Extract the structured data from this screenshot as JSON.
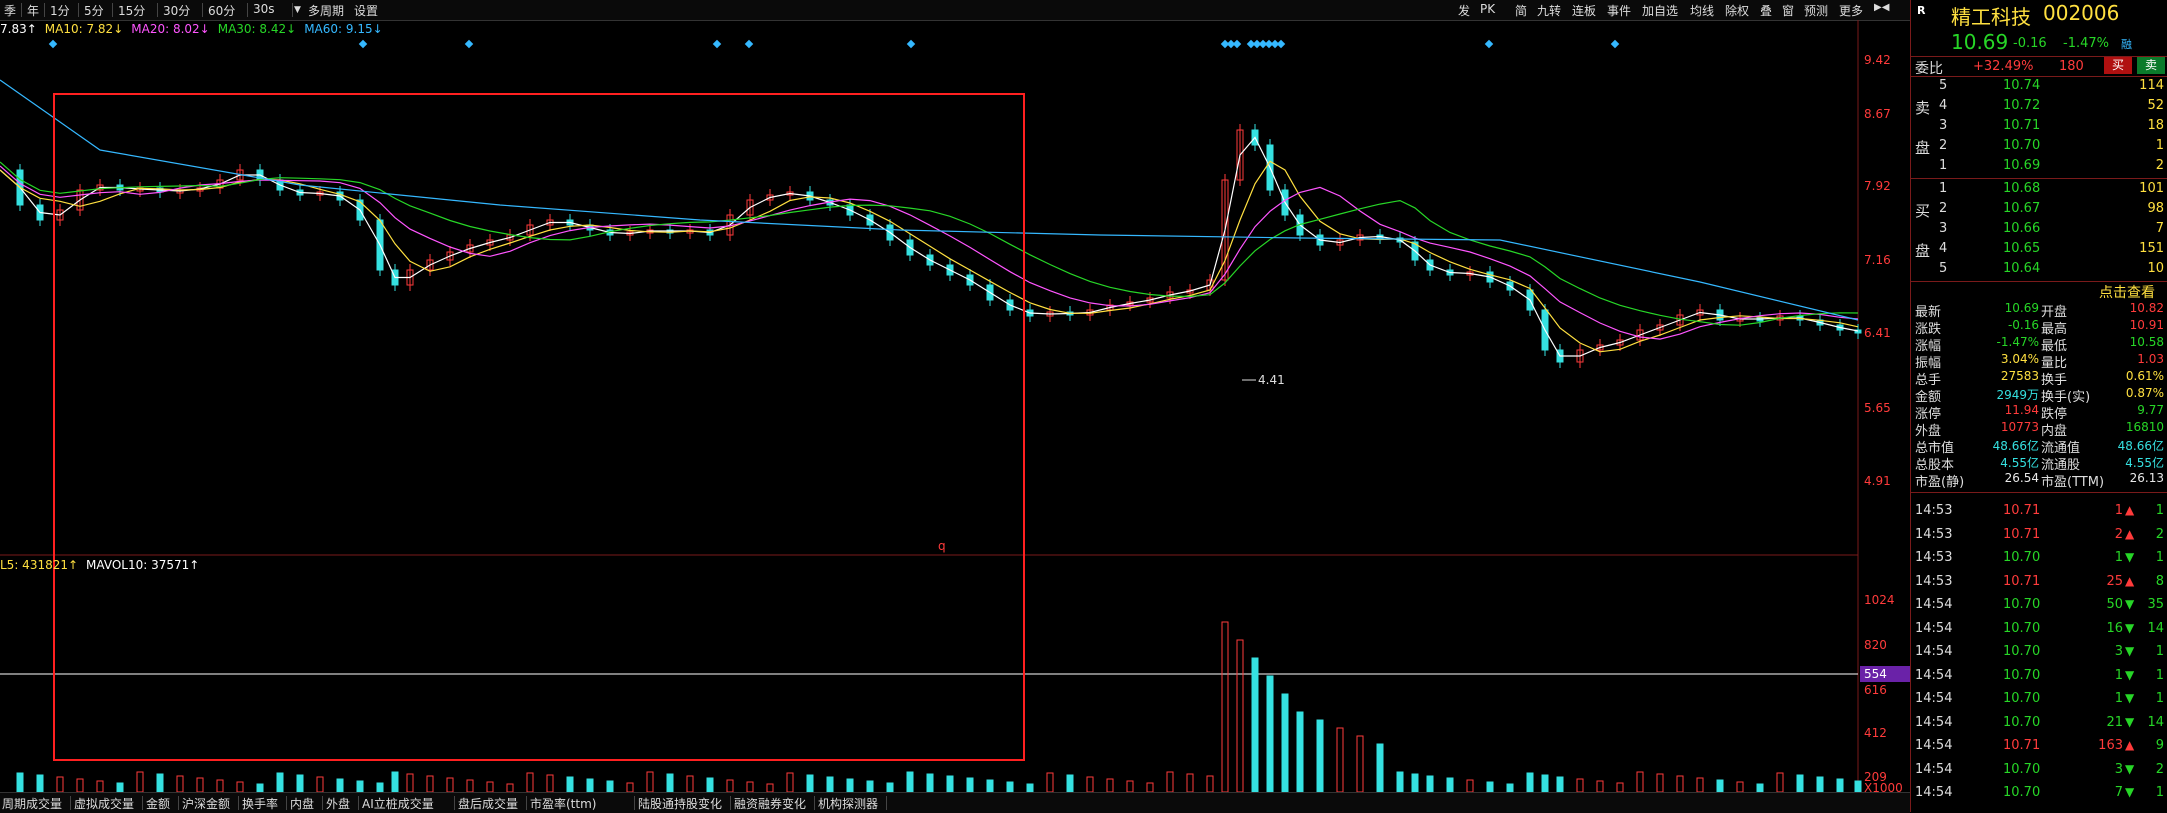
{
  "toolbar": {
    "periods": [
      "季",
      "年",
      "1分",
      "5分",
      "15分",
      "30分",
      "60分",
      "30s"
    ],
    "period_menu": "多周期",
    "settings": "设置",
    "right_items": [
      "发",
      "PK",
      "简",
      "九转",
      "连板",
      "事件",
      "加自选",
      "均线",
      "除权",
      "叠",
      "窗",
      "预测",
      "更多"
    ]
  },
  "ma_legend": [
    {
      "text": "7.83↑",
      "color": "#ffffff"
    },
    {
      "text": "MA10: 7.82↓",
      "color": "#ffe040"
    },
    {
      "text": "MA20: 8.02↓",
      "color": "#ff55ff"
    },
    {
      "text": "MA30: 8.42↓",
      "color": "#27d627"
    },
    {
      "text": "MA60: 9.15↓",
      "color": "#35b8ff"
    }
  ],
  "price_axis": [
    "9.42",
    "8.67",
    "7.92",
    "7.16",
    "6.41",
    "5.65",
    "4.91"
  ],
  "vol_axis": [
    "1024",
    "820",
    "616",
    "412",
    "209",
    "X1000"
  ],
  "vol_marker": "554",
  "low_label": "4.41",
  "selection_letter": "q",
  "vol_legend": [
    {
      "text": "L5: 431821↑",
      "color": "#ffe040"
    },
    {
      "text": "MAVOL10: 37571↑",
      "color": "#ffffff"
    }
  ],
  "bottom_tabs": [
    "周期成交量",
    "虚拟成交量",
    "金额",
    "沪深金额",
    "换手率",
    "内盘",
    "外盘",
    "AI立桩成交量",
    "盘后成交量",
    "市盈率(ttm)",
    "陆股通持股变化",
    "融资融券变化",
    "机构探测器"
  ],
  "stock": {
    "name": "精工科技",
    "code": "002006",
    "price": "10.69",
    "change": "-0.16",
    "change_pct": "-1.47%",
    "flag": "融",
    "r_icon": "R"
  },
  "weibi": {
    "label": "委比",
    "value": "+32.49%",
    "diff": "180",
    "buy": "买",
    "sell": "卖"
  },
  "asks": [
    {
      "lvl": "5",
      "price": "10.74",
      "vol": "114"
    },
    {
      "lvl": "4",
      "price": "10.72",
      "vol": "52"
    },
    {
      "lvl": "3",
      "price": "10.71",
      "vol": "18"
    },
    {
      "lvl": "2",
      "price": "10.70",
      "vol": "1"
    },
    {
      "lvl": "1",
      "price": "10.69",
      "vol": "2"
    }
  ],
  "bids": [
    {
      "lvl": "1",
      "price": "10.68",
      "vol": "101"
    },
    {
      "lvl": "2",
      "price": "10.67",
      "vol": "98"
    },
    {
      "lvl": "3",
      "price": "10.66",
      "vol": "7"
    },
    {
      "lvl": "4",
      "price": "10.65",
      "vol": "151"
    },
    {
      "lvl": "5",
      "price": "10.64",
      "vol": "10"
    }
  ],
  "ask_side_label": [
    "卖",
    "盘"
  ],
  "bid_side_label": [
    "买",
    "盘"
  ],
  "click_view": "点击查看",
  "quote": [
    {
      "l1": "最新",
      "v1": "10.69",
      "c1": "green",
      "l2": "开盘",
      "v2": "10.82",
      "c2": "red"
    },
    {
      "l1": "涨跌",
      "v1": "-0.16",
      "c1": "green",
      "l2": "最高",
      "v2": "10.91",
      "c2": "red"
    },
    {
      "l1": "涨幅",
      "v1": "-1.47%",
      "c1": "green",
      "l2": "最低",
      "v2": "10.58",
      "c2": "green"
    },
    {
      "l1": "振幅",
      "v1": "3.04%",
      "c1": "yellow",
      "l2": "量比",
      "v2": "1.03",
      "c2": "red"
    },
    {
      "l1": "总手",
      "v1": "27583",
      "c1": "yellow",
      "l2": "换手",
      "v2": "0.61%",
      "c2": "yellow"
    },
    {
      "l1": "金额",
      "v1": "2949万",
      "c1": "cyan",
      "l2": "换手(实)",
      "v2": "0.87%",
      "c2": "yellow"
    },
    {
      "l1": "涨停",
      "v1": "11.94",
      "c1": "red",
      "l2": "跌停",
      "v2": "9.77",
      "c2": "green"
    },
    {
      "l1": "外盘",
      "v1": "10773",
      "c1": "red",
      "l2": "内盘",
      "v2": "16810",
      "c2": "green"
    },
    {
      "l1": "总市值",
      "v1": "48.66亿",
      "c1": "cyan",
      "l2": "流通值",
      "v2": "48.66亿",
      "c2": "cyan"
    },
    {
      "l1": "总股本",
      "v1": "4.55亿",
      "c1": "cyan",
      "l2": "流通股",
      "v2": "4.55亿",
      "c2": "cyan"
    },
    {
      "l1": "市盈(静)",
      "v1": "26.54",
      "c1": "white",
      "l2": "市盈(TTM)",
      "v2": "26.13",
      "c2": "white"
    }
  ],
  "ticks": [
    {
      "t": "14:53",
      "p": "10.71",
      "pc": "red",
      "v": "1",
      "dir": "up",
      "n": "1"
    },
    {
      "t": "14:53",
      "p": "10.71",
      "pc": "red",
      "v": "2",
      "dir": "up",
      "n": "2"
    },
    {
      "t": "14:53",
      "p": "10.70",
      "pc": "green",
      "v": "1",
      "dir": "down",
      "n": "1"
    },
    {
      "t": "14:53",
      "p": "10.71",
      "pc": "red",
      "v": "25",
      "dir": "up",
      "n": "8"
    },
    {
      "t": "14:54",
      "p": "10.70",
      "pc": "green",
      "v": "50",
      "dir": "down",
      "n": "35"
    },
    {
      "t": "14:54",
      "p": "10.70",
      "pc": "green",
      "v": "16",
      "dir": "down",
      "n": "14"
    },
    {
      "t": "14:54",
      "p": "10.70",
      "pc": "green",
      "v": "3",
      "dir": "down",
      "n": "1"
    },
    {
      "t": "14:54",
      "p": "10.70",
      "pc": "green",
      "v": "1",
      "dir": "down",
      "n": "1"
    },
    {
      "t": "14:54",
      "p": "10.70",
      "pc": "green",
      "v": "1",
      "dir": "down",
      "n": "1"
    },
    {
      "t": "14:54",
      "p": "10.70",
      "pc": "green",
      "v": "21",
      "dir": "down",
      "n": "14"
    },
    {
      "t": "14:54",
      "p": "10.71",
      "pc": "red",
      "v": "163",
      "dir": "up",
      "n": "9"
    },
    {
      "t": "14:54",
      "p": "10.70",
      "pc": "green",
      "v": "3",
      "dir": "down",
      "n": "2"
    },
    {
      "t": "14:54",
      "p": "10.70",
      "pc": "green",
      "v": "7",
      "dir": "down",
      "n": "1"
    }
  ],
  "colors": {
    "up": "#ff3b3b",
    "down": "#35e0e0",
    "ma5": "#ffffff",
    "ma10": "#ffe040",
    "ma20": "#ff55ff",
    "ma30": "#27d627",
    "ma60": "#35b8ff",
    "frame": "#ff2020"
  }
}
